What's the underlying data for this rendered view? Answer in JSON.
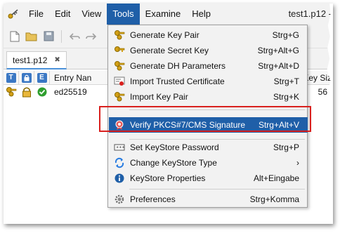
{
  "menubar": {
    "items": [
      "File",
      "Edit",
      "View",
      "Tools",
      "Examine",
      "Help"
    ],
    "active": "Tools",
    "window_title": "test1.p12 -"
  },
  "tab": {
    "label": "test1.p12",
    "close": "✖"
  },
  "table": {
    "header_badges": [
      "T",
      "",
      "E"
    ],
    "entry_name_header": "Entry Nan",
    "key_size_header": "Key Siz",
    "row": {
      "entry_name": "ed25519",
      "key_size": "56"
    }
  },
  "tools_menu": {
    "items": [
      {
        "label": "Generate Key Pair",
        "shortcut": "Strg+G",
        "icon": "key-pair-icon"
      },
      {
        "label": "Generate Secret Key",
        "shortcut": "Strg+Alt+G",
        "icon": "secret-key-icon"
      },
      {
        "label": "Generate DH Parameters",
        "shortcut": "Strg+Alt+D",
        "icon": "dh-parameters-icon"
      },
      {
        "label": "Import Trusted Certificate",
        "shortcut": "Strg+T",
        "icon": "certificate-icon"
      },
      {
        "label": "Import Key Pair",
        "shortcut": "Strg+K",
        "icon": "import-key-pair-icon"
      },
      {
        "label": "Verify PKCS#7/CMS Signature",
        "shortcut": "Strg+Alt+V",
        "icon": "verify-signature-icon"
      },
      {
        "label": "Set KeyStore Password",
        "shortcut": "Strg+P",
        "icon": "password-icon"
      },
      {
        "label": "Change KeyStore Type",
        "shortcut": "",
        "icon": "change-type-icon",
        "submenu_arrow": "›"
      },
      {
        "label": "KeyStore Properties",
        "shortcut": "Alt+Eingabe",
        "icon": "properties-icon"
      },
      {
        "label": "Preferences",
        "shortcut": "Strg+Komma",
        "icon": "gear-icon"
      }
    ],
    "highlighted": "Verify PKCS#7/CMS Signature"
  },
  "colors": {
    "accent": "#1f5fa8",
    "annotation_red": "#d9201e",
    "key_gold": "#d4a017"
  }
}
